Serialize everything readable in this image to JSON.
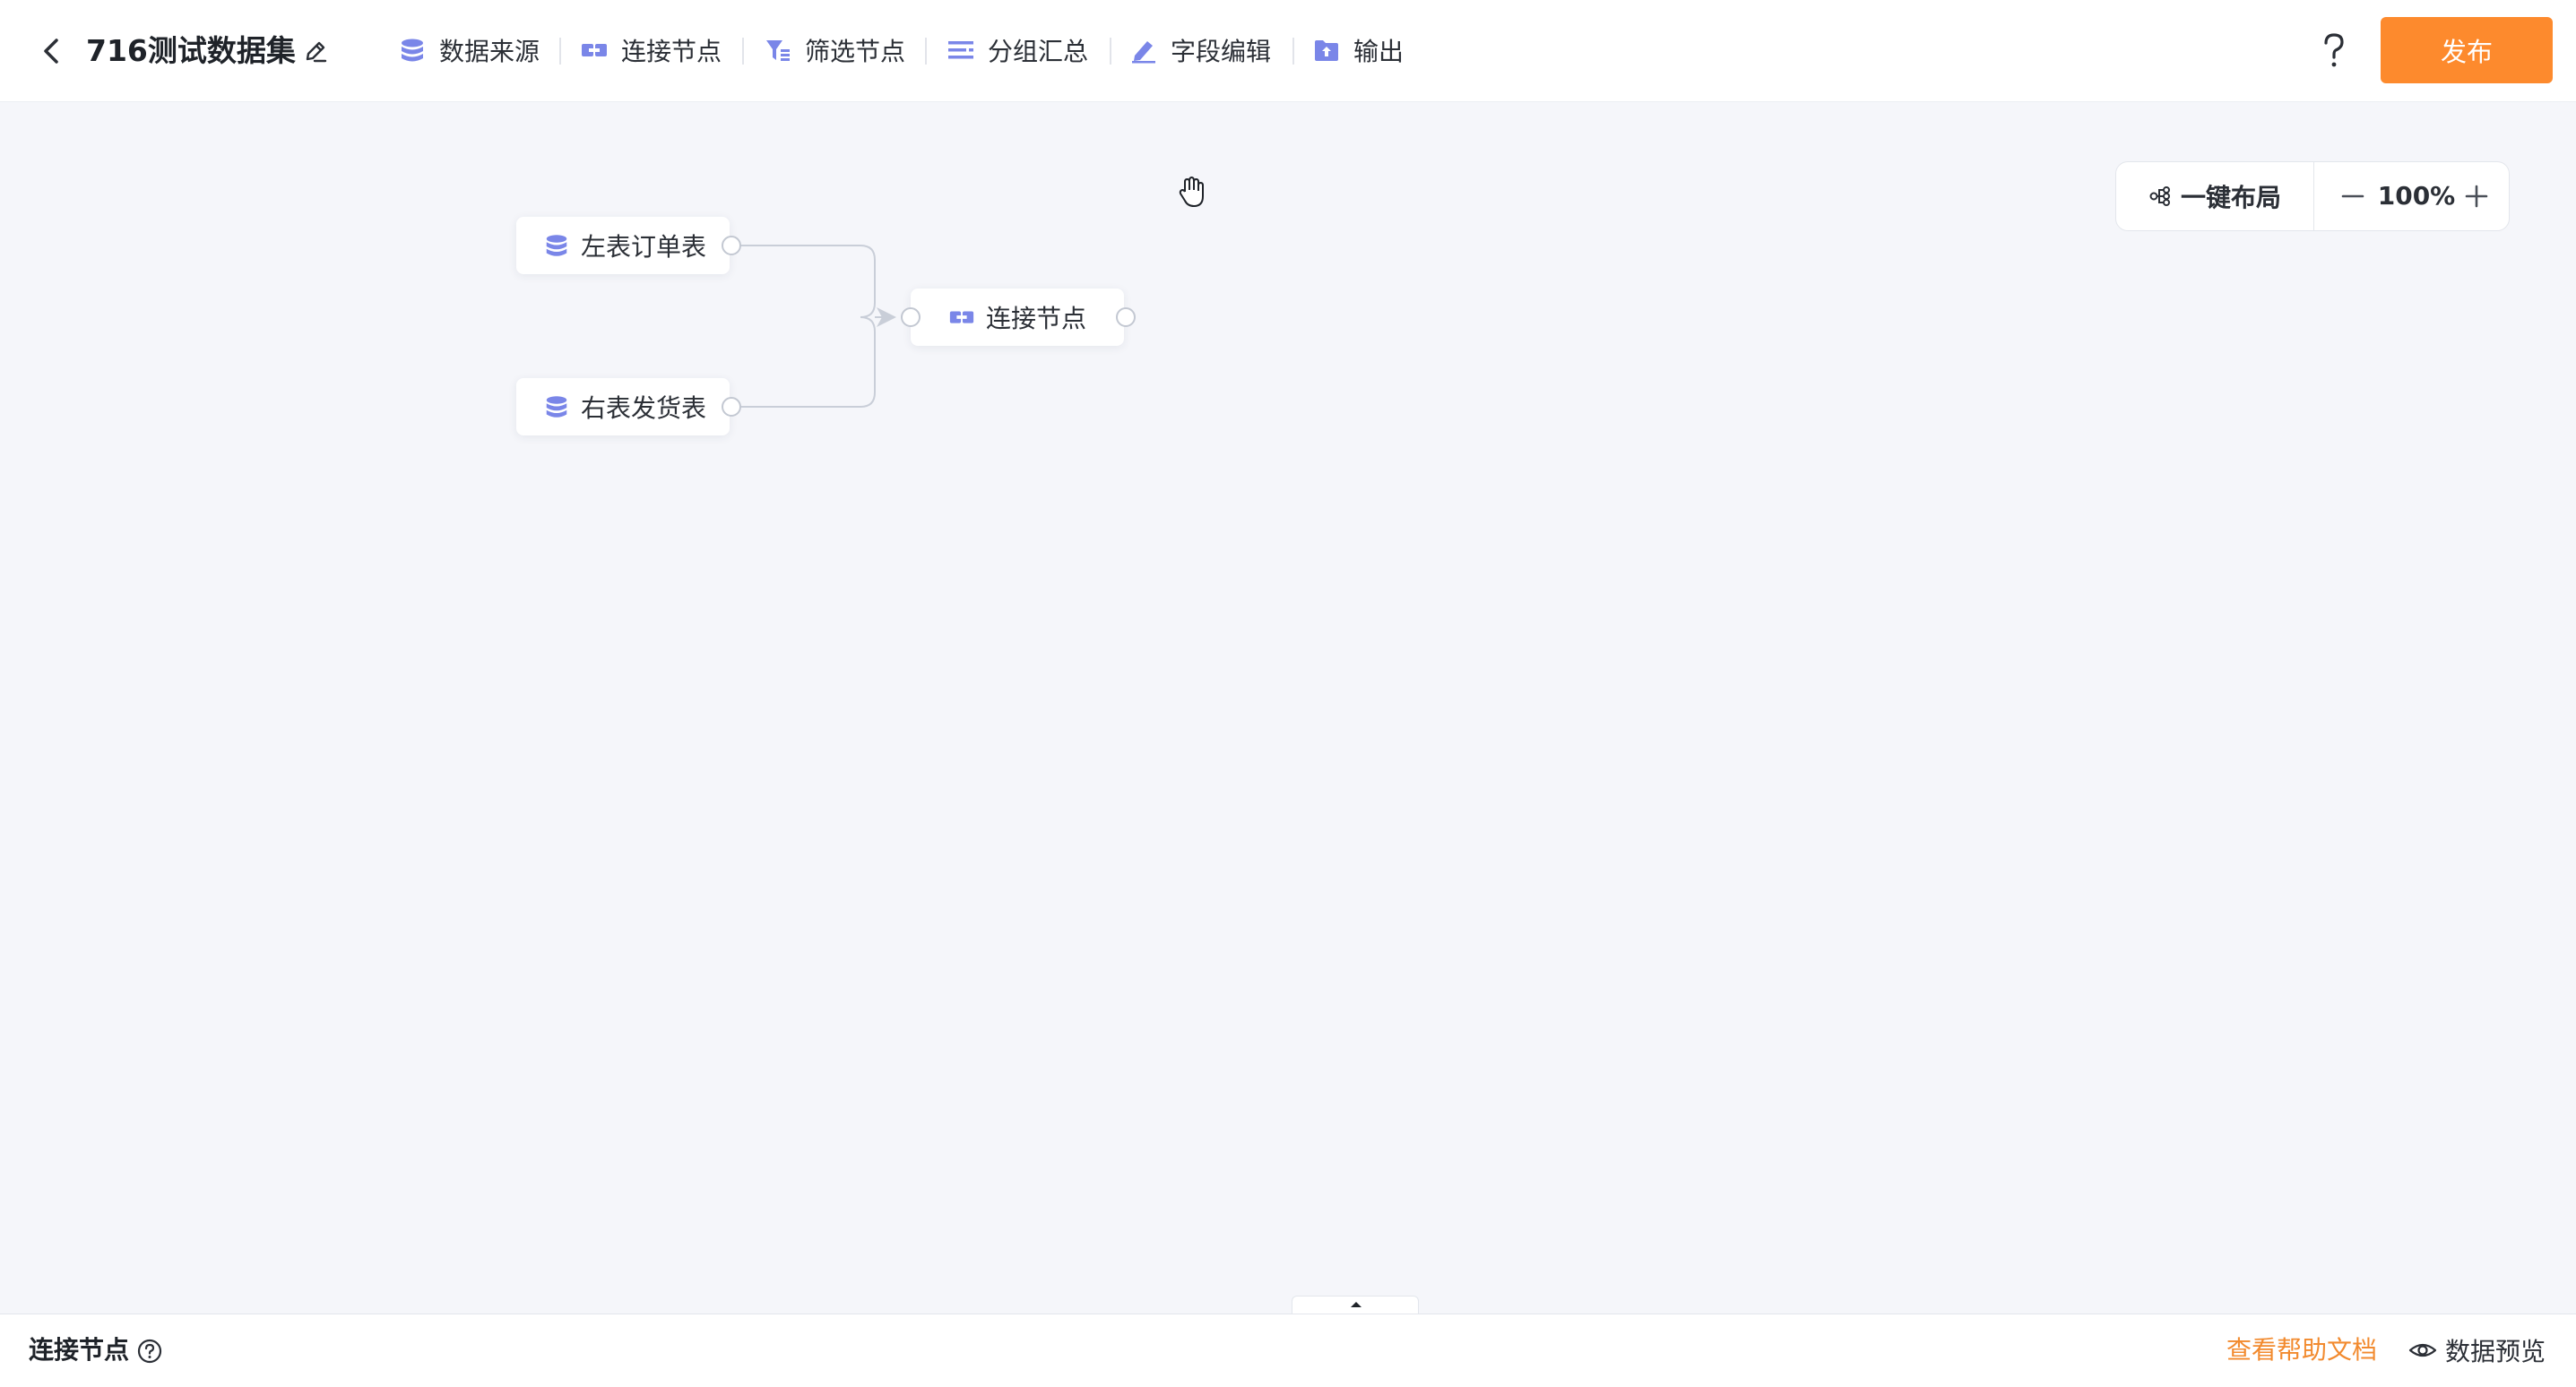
{
  "header": {
    "title": "716测试数据集",
    "toolbar": [
      {
        "label": "数据来源",
        "icon": "database-icon"
      },
      {
        "label": "连接节点",
        "icon": "join-icon"
      },
      {
        "label": "筛选节点",
        "icon": "filter-icon"
      },
      {
        "label": "分组汇总",
        "icon": "group-list-icon"
      },
      {
        "label": "字段编辑",
        "icon": "pen-icon"
      },
      {
        "label": "输出",
        "icon": "output-folder-icon"
      }
    ],
    "publish_label": "发布"
  },
  "canvas": {
    "nodes": [
      {
        "label": "左表订单表",
        "icon": "database-icon"
      },
      {
        "label": "右表发货表",
        "icon": "database-icon"
      },
      {
        "label": "连接节点",
        "icon": "join-icon"
      }
    ],
    "auto_layout_label": "一键布局",
    "zoom_level": "100%"
  },
  "bottom_bar": {
    "title": "连接节点",
    "help_doc_label": "查看帮助文档",
    "preview_label": "数据预览"
  },
  "colors": {
    "accent": "#fd8a2d",
    "link": "#f28a2e",
    "icon_purple": "#7a86e8",
    "canvas_bg": "#f5f6fa"
  }
}
